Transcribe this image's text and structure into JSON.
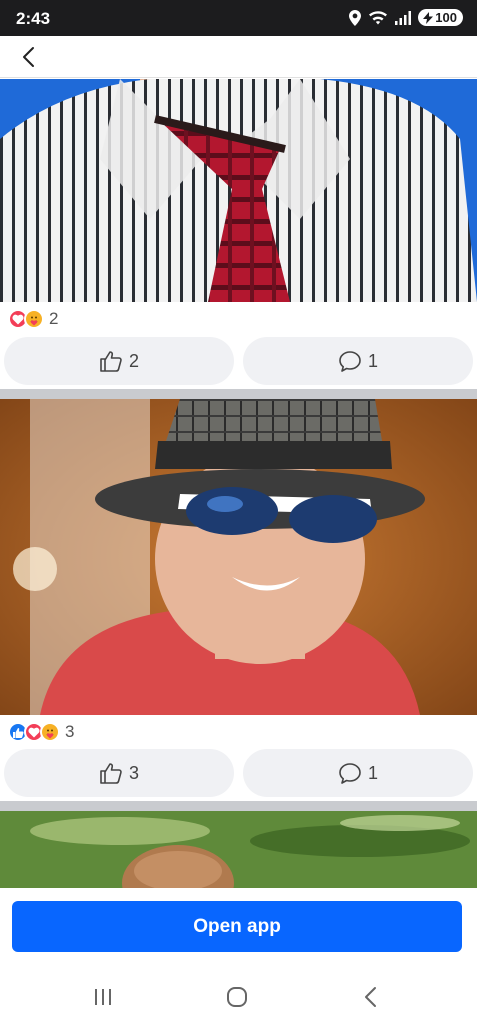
{
  "status_bar": {
    "time": "2:43",
    "battery": "100",
    "icons": [
      "location-icon",
      "wifi-icon",
      "signal-icon",
      "battery-icon"
    ]
  },
  "header": {
    "back_icon": "back-arrow-icon"
  },
  "posts": [
    {
      "reaction_icons": [
        "love-reaction-icon",
        "care-reaction-icon"
      ],
      "reaction_count": "2",
      "like_count": "2",
      "comment_count": "1"
    },
    {
      "reaction_icons": [
        "like-reaction-icon",
        "love-reaction-icon",
        "care-reaction-icon"
      ],
      "reaction_count": "3",
      "like_count": "3",
      "comment_count": "1"
    }
  ],
  "cta": {
    "label": "Open app"
  },
  "nav": {
    "icons": [
      "recent-apps-icon",
      "home-icon",
      "back-icon"
    ]
  },
  "colors": {
    "accent": "#0866ff",
    "like": "#1877f2",
    "love": "#f33e58",
    "care": "#f7b125",
    "divider": "#c9cbcf"
  }
}
